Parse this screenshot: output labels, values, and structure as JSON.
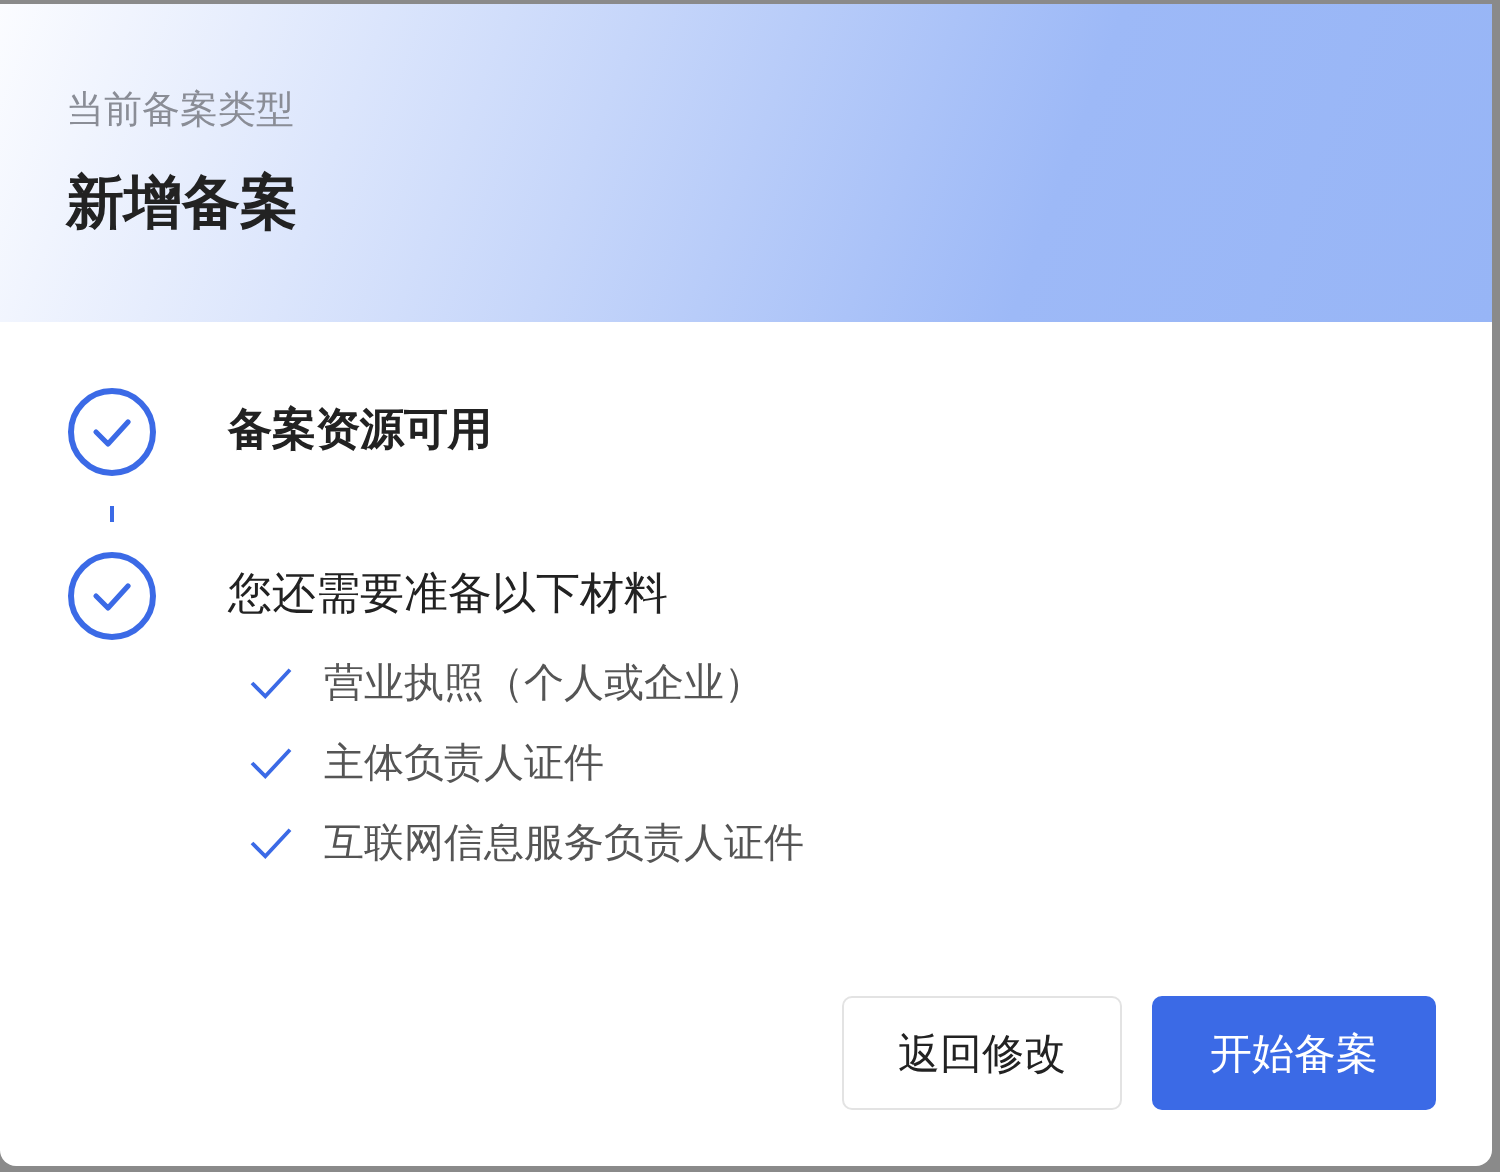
{
  "header": {
    "subtitle": "当前备案类型",
    "title": "新增备案"
  },
  "steps": [
    {
      "kind": "status",
      "title": "备案资源可用"
    },
    {
      "kind": "checklist",
      "title": "您还需要准备以下材料",
      "items": [
        "营业执照（个人或企业）",
        "主体负责人证件",
        "互联网信息服务负责人证件"
      ]
    }
  ],
  "buttons": [
    {
      "label": "返回修改",
      "kind": "secondary"
    },
    {
      "label": "开始备案",
      "kind": "primary"
    }
  ]
}
